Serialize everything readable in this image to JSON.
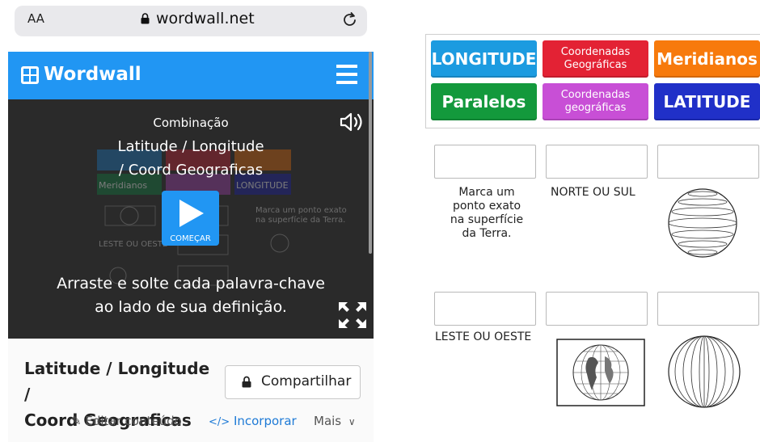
{
  "browser": {
    "text_size_label": "AA",
    "url": "wordwall.net"
  },
  "header": {
    "brand": "Wordwall"
  },
  "player": {
    "activity_type": "Combinação",
    "title_line1": "Latitude / Longitude",
    "title_line2": "/ Coord Geograficas",
    "start_label": "COMEÇAR",
    "instructions_line1": "Arraste e solte cada palavra-chave",
    "instructions_line2": "ao lado de sua definição.",
    "preview_texts": [
      "Meridianos",
      "LONGITUDE",
      "Marca um ponto exato na superfície da Terra.",
      "LESTE OU OESTE"
    ]
  },
  "activity": {
    "title_line1": "Latitude / Longitude /",
    "title_line2": "Coord Geograficas",
    "share_label": "Compartilhar",
    "edit_label": "Editar conteúdo",
    "embed_label": "Incorporar",
    "more_label": "Mais"
  },
  "game": {
    "tiles": [
      {
        "label": "LONGITUDE",
        "color": "#1c9be0"
      },
      {
        "label": "Coordenadas\nGeográficas",
        "color": "#e32234"
      },
      {
        "label": "Meridianos",
        "color": "#f77a0c"
      },
      {
        "label": "Paralelos",
        "color": "#13993c"
      },
      {
        "label": "Coordenadas\ngeográficas",
        "color": "#c84fd6"
      },
      {
        "label": "LATITUDE",
        "color": "#2030c8"
      }
    ],
    "definitions": {
      "def1": "Marca um\nponto exato\nna superfície\nda Terra.",
      "def2": "NORTE OU SUL",
      "def4": "LESTE OU OESTE"
    }
  },
  "colors": {
    "brand_blue": "#2196f3",
    "player_bg": "#2a2a2a",
    "link_blue": "#1e7ad6"
  }
}
